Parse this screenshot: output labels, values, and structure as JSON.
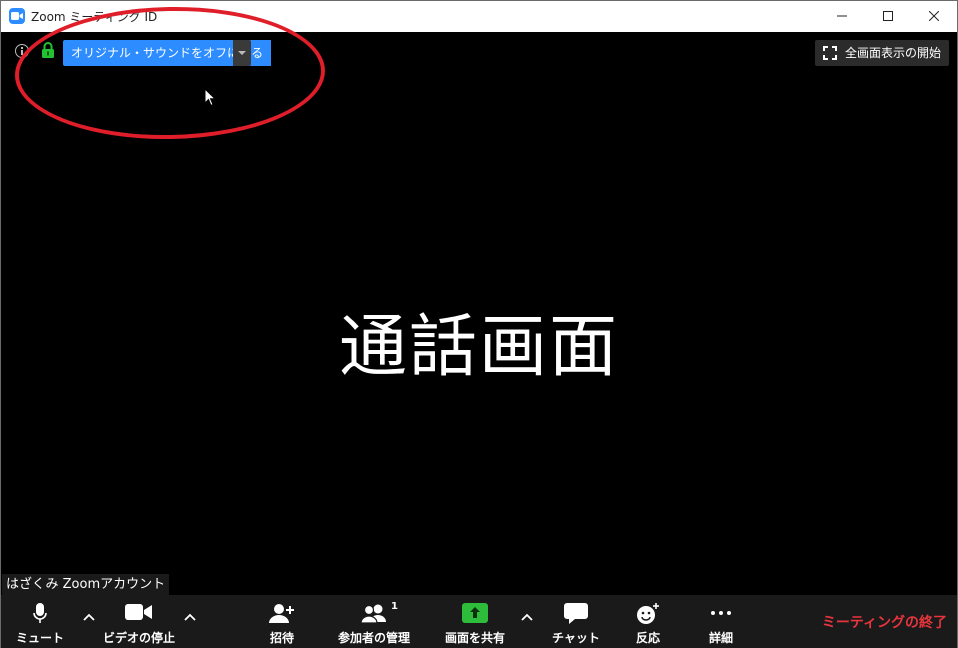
{
  "window": {
    "title": "Zoom ミーティング ID"
  },
  "topbar": {
    "original_sound_button": "オリジナル・サウンドをオフにする",
    "fullscreen_button": "全画面表示の開始"
  },
  "main": {
    "center_text": "通話画面",
    "participant_name": "はざくみ Zoomアカウント"
  },
  "toolbar": {
    "mute_label": "ミュート",
    "video_label": "ビデオの停止",
    "invite_label": "招待",
    "participants_label": "参加者の管理",
    "participants_count": "1",
    "share_label": "画面を共有",
    "chat_label": "チャット",
    "reactions_label": "反応",
    "more_label": "詳細",
    "end_label": "ミーティングの終了"
  },
  "colors": {
    "accent": "#2d8cff",
    "share_green": "#2dbd3a",
    "end_red": "#e8353d",
    "highlight_red": "#e01e2a",
    "lock_green": "#23c233"
  },
  "icons": [
    "zoom-app-icon",
    "minimize-icon",
    "maximize-icon",
    "close-icon",
    "info-icon",
    "lock-icon",
    "fullscreen-icon",
    "microphone-icon",
    "video-camera-icon",
    "invite-icon",
    "participants-icon",
    "share-screen-icon",
    "chat-icon",
    "reactions-icon",
    "more-icon",
    "chevron-up-icon",
    "cursor-icon"
  ]
}
